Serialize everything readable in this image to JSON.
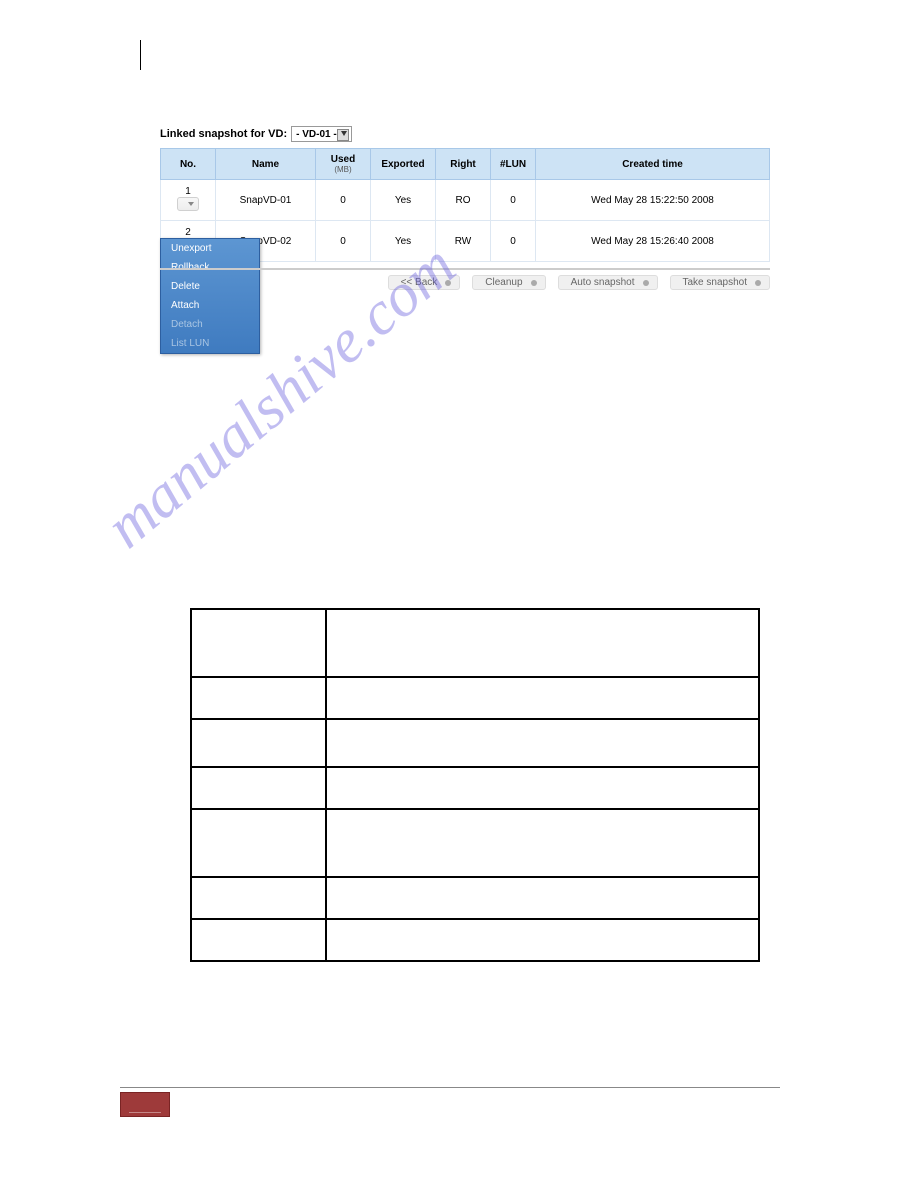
{
  "header": {
    "label": "Linked snapshot for VD:",
    "dropdown_value": "- VD-01 -"
  },
  "table": {
    "headers": {
      "no": "No.",
      "name": "Name",
      "used": "Used",
      "used_sub": "(MB)",
      "exported": "Exported",
      "right": "Right",
      "lun": "#LUN",
      "created": "Created time"
    },
    "rows": [
      {
        "no": "1",
        "name": "SnapVD-01",
        "used": "0",
        "exported": "Yes",
        "right": "RO",
        "lun": "0",
        "created": "Wed May 28 15:22:50 2008"
      },
      {
        "no": "2",
        "name": "SnapVD-02",
        "used": "0",
        "exported": "Yes",
        "right": "RW",
        "lun": "0",
        "created": "Wed May 28 15:26:40 2008"
      }
    ]
  },
  "context_menu": {
    "items": [
      {
        "label": "Unexport",
        "disabled": false
      },
      {
        "label": "Rollback",
        "disabled": false
      },
      {
        "label": "Delete",
        "disabled": false
      },
      {
        "label": "Attach",
        "disabled": false
      },
      {
        "label": "Detach",
        "disabled": true
      },
      {
        "label": "List LUN",
        "disabled": true
      }
    ]
  },
  "toolbar": {
    "back": "<< Back",
    "cleanup": "Cleanup",
    "auto": "Auto snapshot",
    "take": "Take snapshot"
  },
  "watermark": "manualshive.com"
}
